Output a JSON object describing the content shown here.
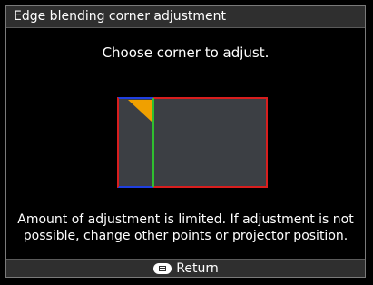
{
  "dialog": {
    "title": "Edge blending corner adjustment",
    "instruction": "Choose corner to adjust.",
    "notice_line1": "Amount of adjustment is limited. If adjustment is not",
    "notice_line2": "possible, change other points or projector position."
  },
  "footer": {
    "return_label": "Return",
    "return_icon": "menu-button-icon"
  },
  "colors": {
    "background": "#000000",
    "bar": "#2f2f2f",
    "projection_fill": "#3c3f44",
    "outline_red": "#d81e1e",
    "edge_green": "#2fbf2f",
    "edge_blue": "#1f3fe0",
    "selected_corner": "#f0a000"
  }
}
